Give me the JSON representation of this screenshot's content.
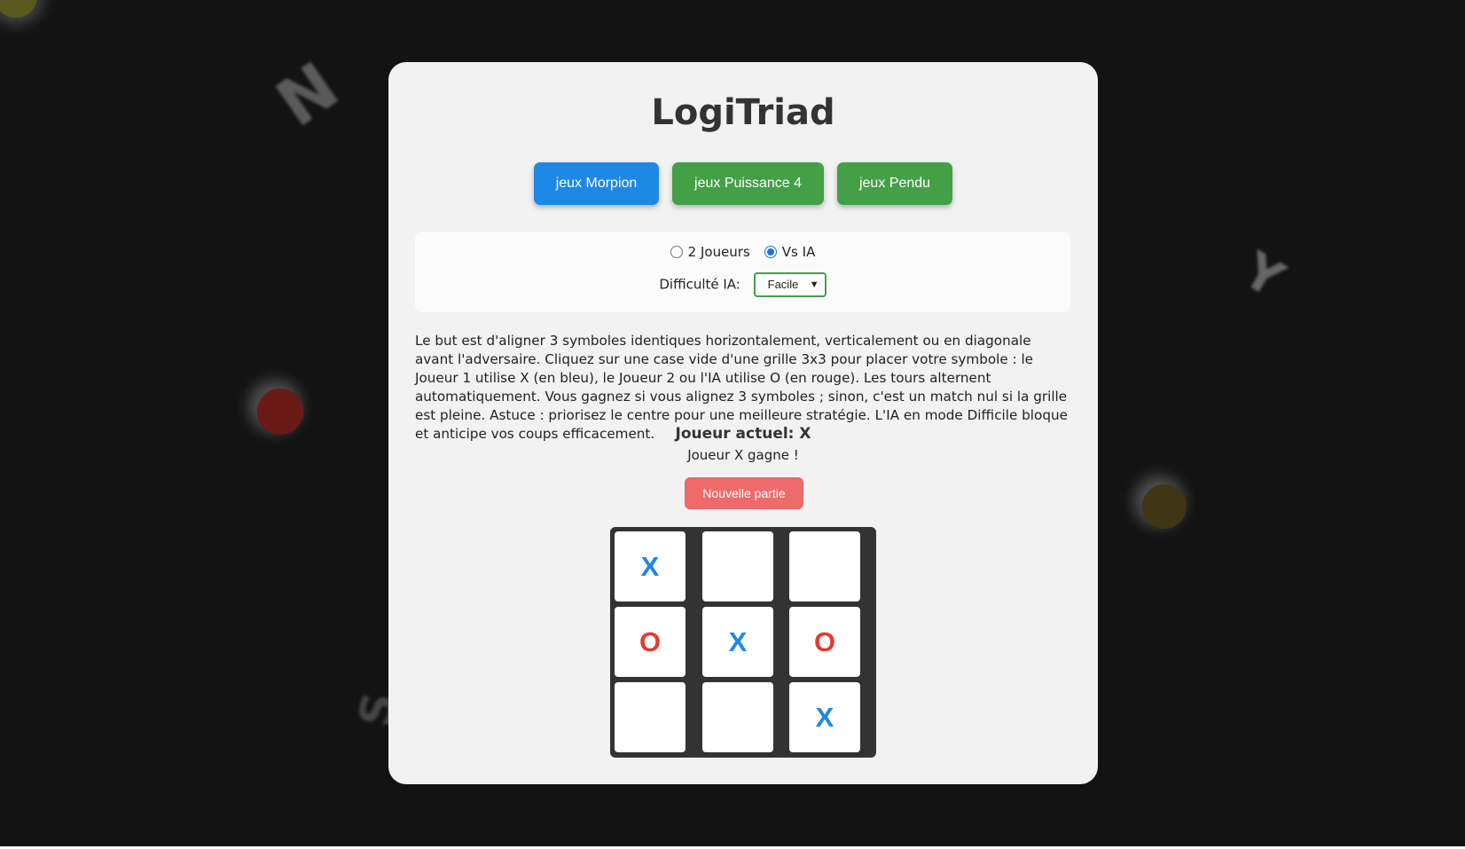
{
  "app": {
    "title": "LogiTriad"
  },
  "colors": {
    "page_bg": "#131313",
    "card_bg": "#f2f2f2",
    "active_tab": "#1e88e5",
    "tab": "#43a047",
    "player_x": "#1e88e5",
    "player_o": "#e53935",
    "new_game": "#ef6a6a",
    "board": "#333333"
  },
  "nav": {
    "morpion": "jeux Morpion",
    "puissance4": "jeux Puissance 4",
    "pendu": "jeux Pendu",
    "active": "jeux Morpion"
  },
  "mode": {
    "two_players": "2 Joueurs",
    "vs_ai": "Vs IA",
    "selected": "Vs IA"
  },
  "difficulty": {
    "label": "Difficulté IA:",
    "value": "Facile"
  },
  "rules_text": "Le but est d'aligner 3 symboles identiques horizontalement, verticalement ou en diagonale avant l'adversaire. Cliquez sur une case vide d'une grille 3x3 pour placer votre symbole : le Joueur 1 utilise X (en bleu), le Joueur 2 ou l'IA utilise O (en rouge). Les tours alternent automatiquement. Vous gagnez si vous alignez 3 symboles ; sinon, c'est un match nul si la grille est pleine. Astuce : priorisez le centre pour une meilleure stratégie. L'IA en mode Difficile bloque et anticipe vos coups efficacement.",
  "current_player": "Joueur actuel: X",
  "status": "Joueur X gagne !",
  "new_game_label": "Nouvelle partie",
  "board": [
    [
      "X",
      "",
      ""
    ],
    [
      "O",
      "X",
      "O"
    ],
    [
      "",
      "",
      "X"
    ]
  ]
}
